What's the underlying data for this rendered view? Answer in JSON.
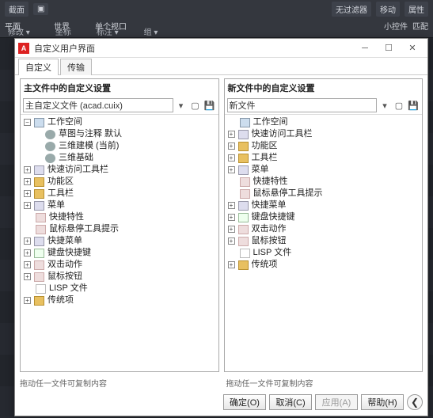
{
  "ribbon": {
    "row1": [
      "截面",
      "▣",
      "无过滤器",
      "移动",
      "属性"
    ],
    "row2": [
      "平面",
      "世界",
      "单个视口",
      "小控件",
      "匹配"
    ],
    "tabs": [
      "修改 ▾",
      "坐标",
      "标注 ▾",
      "组 ▾"
    ]
  },
  "dialog": {
    "title": "自定义用户界面",
    "win_min": "─",
    "win_max": "☐",
    "win_close": "✕",
    "tab1": "自定义",
    "tab2": "传输"
  },
  "left": {
    "title": "主文件中的自定义设置",
    "combo": "主自定义文件 (acad.cuix)",
    "hint": "拖动任一文件可复制内容",
    "tree": [
      {
        "lv": 0,
        "tw": "-",
        "ic": "cube",
        "t": "工作空间"
      },
      {
        "lv": 1,
        "tw": "",
        "ic": "gear",
        "t": "草图与注释  默认"
      },
      {
        "lv": 1,
        "tw": "",
        "ic": "gear",
        "t": "三维建模 (当前)"
      },
      {
        "lv": 1,
        "tw": "",
        "ic": "gear",
        "t": "三维基础"
      },
      {
        "lv": 0,
        "tw": "+",
        "ic": "menu",
        "t": "快速访问工具栏"
      },
      {
        "lv": 0,
        "tw": "+",
        "ic": "folder",
        "t": "功能区"
      },
      {
        "lv": 0,
        "tw": "+",
        "ic": "folder",
        "t": "工具栏"
      },
      {
        "lv": 0,
        "tw": "+",
        "ic": "menu",
        "t": "菜单"
      },
      {
        "lv": 0,
        "tw": "",
        "ic": "hand",
        "t": "快捷特性"
      },
      {
        "lv": 0,
        "tw": "",
        "ic": "hand",
        "t": "鼠标悬停工具提示"
      },
      {
        "lv": 0,
        "tw": "+",
        "ic": "menu",
        "t": "快捷菜单"
      },
      {
        "lv": 0,
        "tw": "+",
        "ic": "key",
        "t": "键盘快捷键"
      },
      {
        "lv": 0,
        "tw": "+",
        "ic": "hand",
        "t": "双击动作"
      },
      {
        "lv": 0,
        "tw": "+",
        "ic": "hand",
        "t": "鼠标按钮"
      },
      {
        "lv": 0,
        "tw": "",
        "ic": "lisp",
        "t": "LISP 文件"
      },
      {
        "lv": 0,
        "tw": "+",
        "ic": "folder",
        "t": "传统项"
      }
    ]
  },
  "right": {
    "title": "新文件中的自定义设置",
    "combo": "新文件",
    "hint": "拖动任一文件可复制内容",
    "tree": [
      {
        "lv": 0,
        "tw": "",
        "ic": "cube",
        "t": "工作空间"
      },
      {
        "lv": 0,
        "tw": "+",
        "ic": "menu",
        "t": "快速访问工具栏"
      },
      {
        "lv": 0,
        "tw": "+",
        "ic": "folder",
        "t": "功能区"
      },
      {
        "lv": 0,
        "tw": "+",
        "ic": "folder",
        "t": "工具栏"
      },
      {
        "lv": 0,
        "tw": "+",
        "ic": "menu",
        "t": "菜单"
      },
      {
        "lv": 0,
        "tw": "",
        "ic": "hand",
        "t": "快捷特性"
      },
      {
        "lv": 0,
        "tw": "",
        "ic": "hand",
        "t": "鼠标悬停工具提示"
      },
      {
        "lv": 0,
        "tw": "+",
        "ic": "menu",
        "t": "快捷菜单"
      },
      {
        "lv": 0,
        "tw": "+",
        "ic": "key",
        "t": "键盘快捷键"
      },
      {
        "lv": 0,
        "tw": "+",
        "ic": "hand",
        "t": "双击动作"
      },
      {
        "lv": 0,
        "tw": "+",
        "ic": "hand",
        "t": "鼠标按钮"
      },
      {
        "lv": 0,
        "tw": "",
        "ic": "lisp",
        "t": "LISP 文件"
      },
      {
        "lv": 0,
        "tw": "+",
        "ic": "folder",
        "t": "传统项"
      }
    ]
  },
  "footer": {
    "ok": "确定(O)",
    "cancel": "取消(C)",
    "apply": "应用(A)",
    "help": "帮助(H)",
    "expand": "❮"
  }
}
